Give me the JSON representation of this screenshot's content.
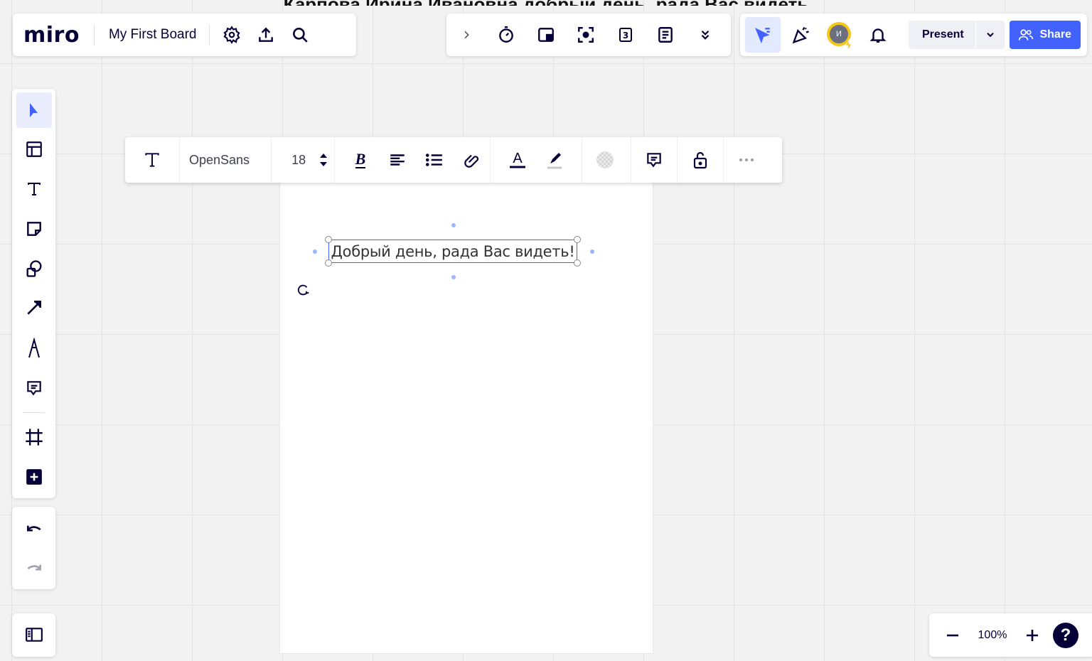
{
  "header_partial_text": "Карпова Ирина Ивановна добрый день, рада Вас видеть",
  "app": {
    "logo": "miro",
    "board_title": "My First Board"
  },
  "top_left_icons": [
    "settings-icon",
    "upload-icon",
    "search-icon"
  ],
  "top_center_icons": [
    "chevron-right-icon",
    "timer-icon",
    "card-icon",
    "focus-icon",
    "counter-icon",
    "notes-icon",
    "double-chevron-down-icon"
  ],
  "top_right": {
    "icons": [
      "select-cursor-icon",
      "celebrate-icon",
      "avatar",
      "bell-icon"
    ],
    "avatar_initial": "И",
    "present_label": "Present",
    "share_label": "Share"
  },
  "left_toolbar": {
    "tools": [
      "select-icon",
      "templates-icon",
      "text-icon",
      "sticky-note-icon",
      "shapes-icon",
      "arrow-icon",
      "pen-icon",
      "comment-icon",
      "frame-icon",
      "add-icon"
    ],
    "active": "select-icon"
  },
  "text_toolbar": {
    "font_name": "OpenSans",
    "font_size": "18",
    "icons": [
      "text-type-icon",
      "font-size-stepper-icon",
      "bold-icon",
      "align-icon",
      "list-icon",
      "link-icon",
      "text-color-icon",
      "highlight-icon",
      "fill-icon",
      "comment-icon",
      "lock-icon",
      "more-icon"
    ]
  },
  "canvas": {
    "selected_text": "Добрый день, рада Вас видеть!"
  },
  "zoom": {
    "level": "100%",
    "help": "?"
  },
  "colors": {
    "accent": "#4262ff",
    "text_dark": "#050038",
    "selection": "#4262ff"
  }
}
